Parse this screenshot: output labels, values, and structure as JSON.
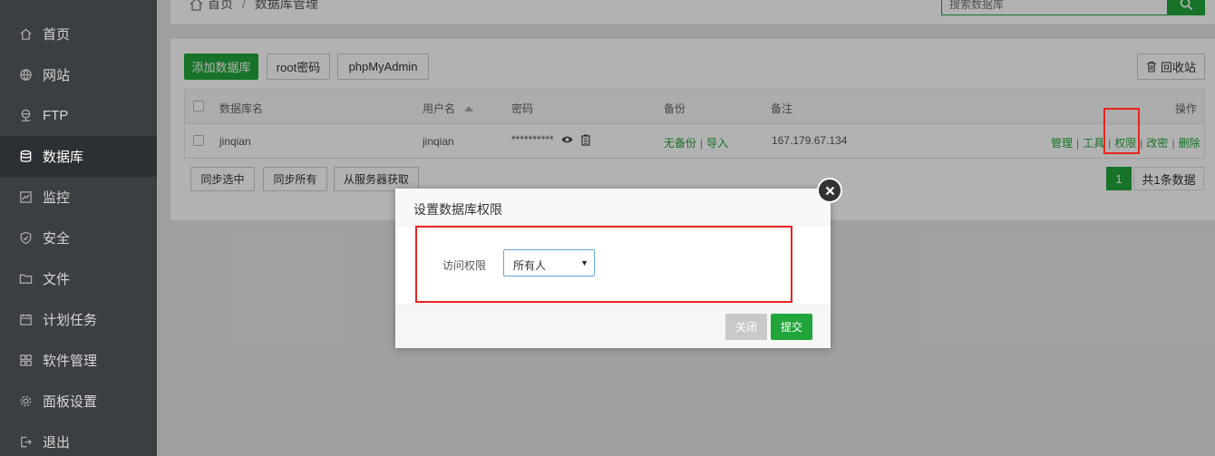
{
  "sidebar": {
    "items": [
      {
        "label": "首页",
        "icon": "home-icon"
      },
      {
        "label": "网站",
        "icon": "globe-icon"
      },
      {
        "label": "FTP",
        "icon": "ftp-icon"
      },
      {
        "label": "数据库",
        "icon": "database-icon",
        "active": true
      },
      {
        "label": "监控",
        "icon": "monitor-icon"
      },
      {
        "label": "安全",
        "icon": "shield-icon"
      },
      {
        "label": "文件",
        "icon": "folder-icon"
      },
      {
        "label": "计划任务",
        "icon": "calendar-icon"
      },
      {
        "label": "软件管理",
        "icon": "apps-icon"
      },
      {
        "label": "面板设置",
        "icon": "gear-icon"
      },
      {
        "label": "退出",
        "icon": "logout-icon"
      }
    ]
  },
  "breadcrumb": {
    "home": "首页",
    "separator": "/",
    "current": "数据库管理"
  },
  "search": {
    "placeholder": "搜索数据库"
  },
  "toolbar": {
    "add_db": "添加数据库",
    "root_pwd": "root密码",
    "phpmyadmin": "phpMyAdmin",
    "recycle": "回收站"
  },
  "table": {
    "headers": {
      "name": "数据库名",
      "user": "用户名",
      "password": "密码",
      "backup": "备份",
      "note": "备注",
      "ops": "操作"
    },
    "rows": [
      {
        "name": "jinqian",
        "user": "jinqian",
        "password": "**********",
        "backup_none": "无备份",
        "backup_import": "导入",
        "note": "167.179.67.134",
        "ops": {
          "manage": "管理",
          "tools": "工具",
          "perm": "权限",
          "change_pwd": "改密",
          "delete": "删除"
        }
      }
    ]
  },
  "bottom_buttons": {
    "sync_selected": "同步选中",
    "sync_all": "同步所有",
    "from_server": "从服务器获取"
  },
  "pager": {
    "current": "1",
    "summary": "共1条数据"
  },
  "modal": {
    "title": "设置数据库权限",
    "label": "访问权限",
    "select_value": "所有人",
    "close_btn": "关闭",
    "submit_btn": "提交"
  },
  "colors": {
    "brand": "#20a53a",
    "highlight": "#e8251d",
    "sidebar": "#3b3f43"
  }
}
